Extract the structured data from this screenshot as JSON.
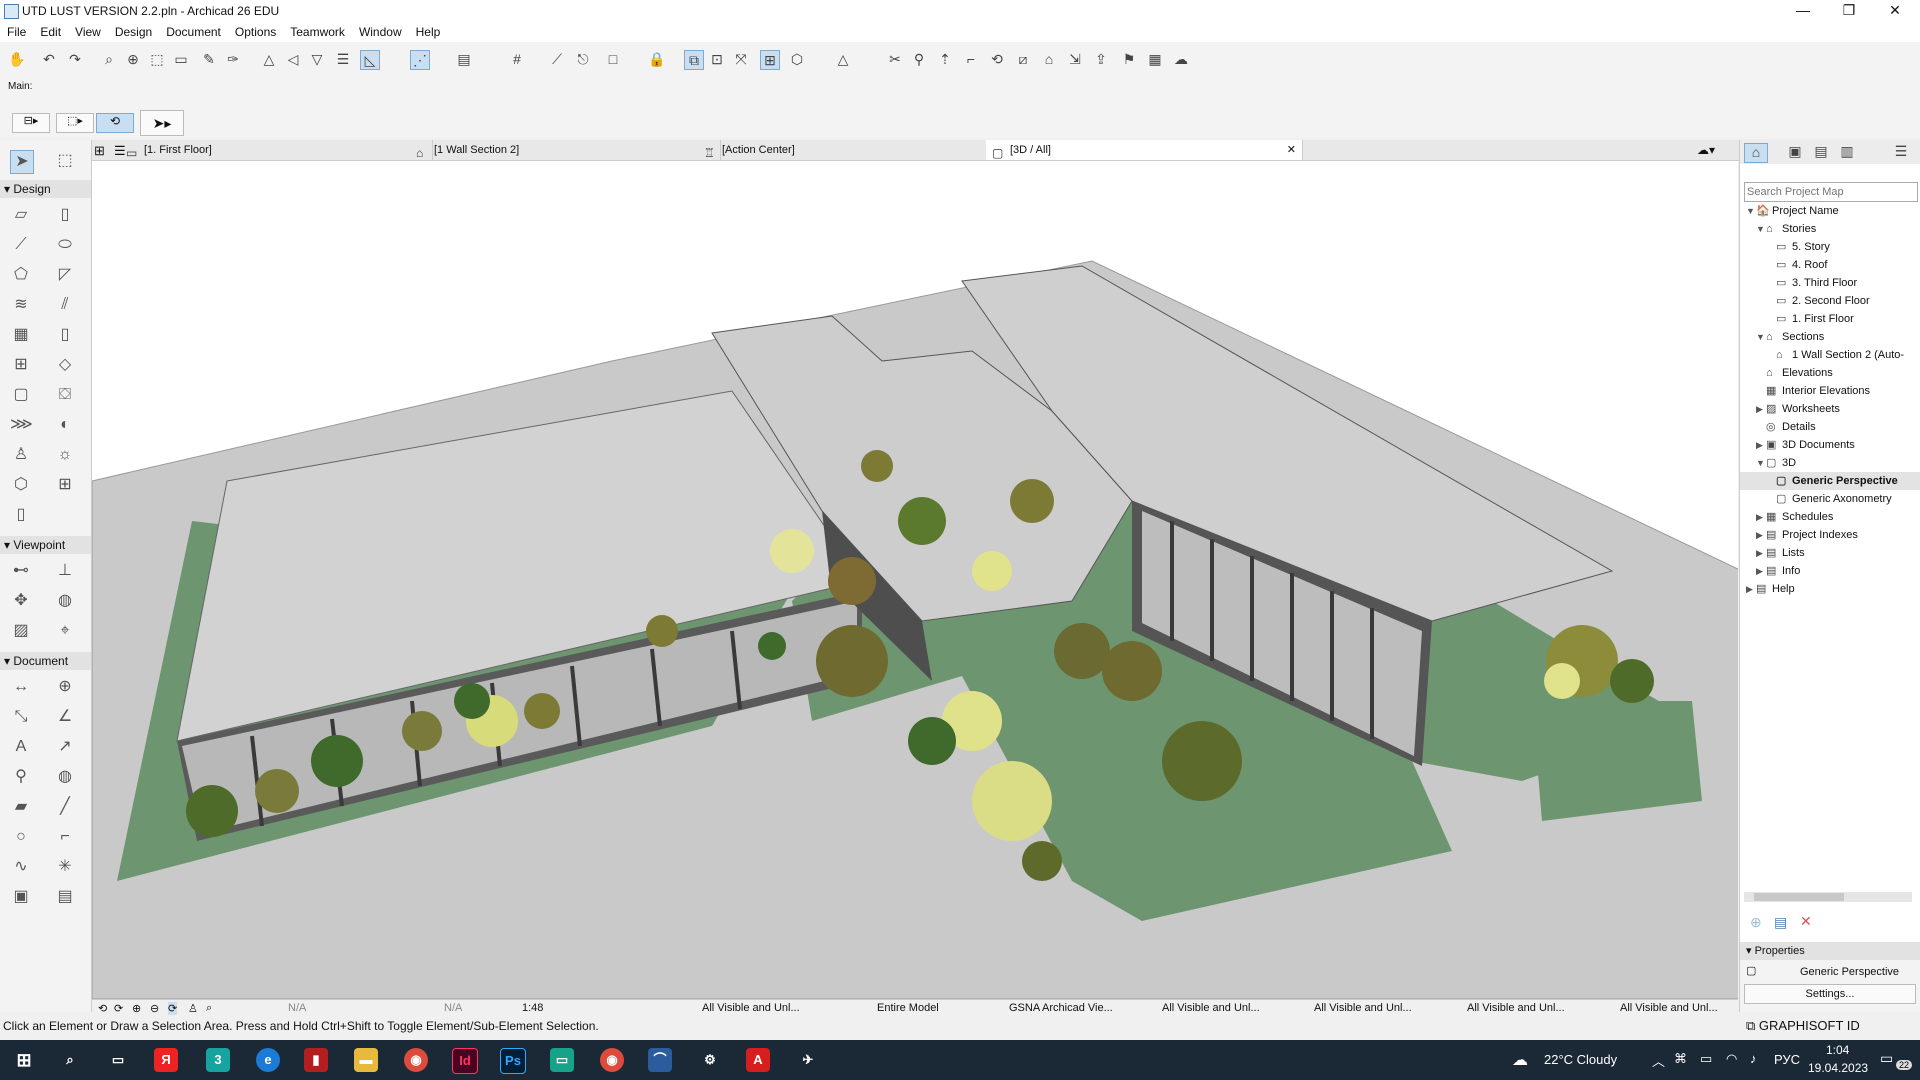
{
  "window": {
    "title": "UTD LUST VERSION 2.2.pln - Archicad 26 EDU",
    "minimize_glyph": "—",
    "maximize_glyph": "❐",
    "close_glyph": "✕"
  },
  "menu": [
    "File",
    "Edit",
    "View",
    "Design",
    "Document",
    "Options",
    "Teamwork",
    "Window",
    "Help"
  ],
  "toolbar": {
    "main_label": "Main:"
  },
  "tabs": [
    {
      "label": "[1. First Floor]",
      "icon": "floorplan-icon"
    },
    {
      "label": "[1 Wall Section 2]",
      "icon": "section-icon"
    },
    {
      "label": "[Action Center]",
      "icon": "action-center-icon"
    },
    {
      "label": "[3D / All]",
      "icon": "3d-icon",
      "close": "✕"
    }
  ],
  "toolbox": {
    "sections": [
      "Design",
      "Viewpoint",
      "Document"
    ]
  },
  "navigator": {
    "search_placeholder": "Search Project Map",
    "tree": [
      {
        "label": "Project Name",
        "level": 0,
        "arrow": "▼",
        "icon": "🏠"
      },
      {
        "label": "Stories",
        "level": 1,
        "arrow": "▼",
        "icon": "⌂"
      },
      {
        "label": "5. Story",
        "level": 2,
        "arrow": "",
        "icon": "▭"
      },
      {
        "label": "4. Roof",
        "level": 2,
        "arrow": "",
        "icon": "▭"
      },
      {
        "label": "3. Third Floor",
        "level": 2,
        "arrow": "",
        "icon": "▭"
      },
      {
        "label": "2. Second Floor",
        "level": 2,
        "arrow": "",
        "icon": "▭"
      },
      {
        "label": "1. First Floor",
        "level": 2,
        "arrow": "",
        "icon": "▭"
      },
      {
        "label": "Sections",
        "level": 1,
        "arrow": "▼",
        "icon": "⌂"
      },
      {
        "label": "1 Wall Section 2 (Auto-",
        "level": 2,
        "arrow": "",
        "icon": "⌂"
      },
      {
        "label": "Elevations",
        "level": 1,
        "arrow": "",
        "icon": "⌂"
      },
      {
        "label": "Interior Elevations",
        "level": 1,
        "arrow": "",
        "icon": "▦"
      },
      {
        "label": "Worksheets",
        "level": 1,
        "arrow": "▶",
        "icon": "▨"
      },
      {
        "label": "Details",
        "level": 1,
        "arrow": "",
        "icon": "◎"
      },
      {
        "label": "3D Documents",
        "level": 1,
        "arrow": "▶",
        "icon": "▣"
      },
      {
        "label": "3D",
        "level": 1,
        "arrow": "▼",
        "icon": "▢"
      },
      {
        "label": "Generic Perspective",
        "level": 2,
        "arrow": "",
        "icon": "▢",
        "selected": true
      },
      {
        "label": "Generic Axonometry",
        "level": 2,
        "arrow": "",
        "icon": "▢"
      },
      {
        "label": "Schedules",
        "level": 1,
        "arrow": "▶",
        "icon": "▦"
      },
      {
        "label": "Project Indexes",
        "level": 1,
        "arrow": "▶",
        "icon": "▤"
      },
      {
        "label": "Lists",
        "level": 1,
        "arrow": "▶",
        "icon": "▤"
      },
      {
        "label": "Info",
        "level": 1,
        "arrow": "▶",
        "icon": "▤"
      },
      {
        "label": "Help",
        "level": 0,
        "arrow": "▶",
        "icon": "▤"
      }
    ],
    "properties_label": "Properties",
    "properties_value": "Generic Perspective",
    "settings_label": "Settings..."
  },
  "view_status": {
    "na1": "N/A",
    "na2": "N/A",
    "scale": "1:48",
    "layer": "All Visible and Unl...",
    "model": "Entire Model",
    "pen": "GSNA Archicad Vie...",
    "filter1": "All Visible and Unl...",
    "filter2": "All Visible and Unl...",
    "filter3": "All Visible and Unl...",
    "filter4": "All Visible and Unl..."
  },
  "hint": "Click an Element or Draw a Selection Area. Press and Hold Ctrl+Shift to Toggle Element/Sub-Element Selection.",
  "graphisoft_id": "GRAPHISOFT ID",
  "taskbar": {
    "weather": "22°C  Cloudy",
    "lang": "РУС",
    "time": "1:04",
    "date": "19.04.2023",
    "notifications": "22"
  },
  "colors": {
    "ground": "#c8c8c8",
    "lawn": "#6d9670",
    "roof": "#cfcfcf",
    "frame": "#4a4a4a",
    "taskbar": "#1b2835"
  }
}
